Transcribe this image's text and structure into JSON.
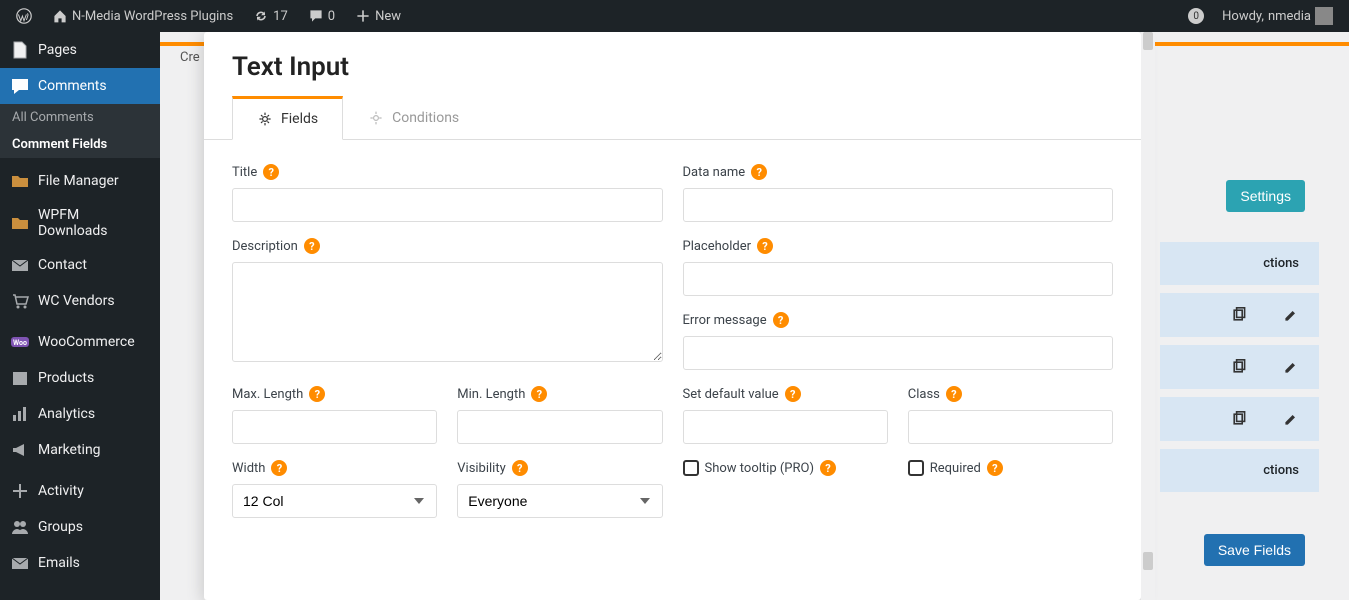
{
  "admin_bar": {
    "site_name": "N-Media WordPress Plugins",
    "updates": "17",
    "comments": "0",
    "new": "New",
    "howdy_prefix": "Howdy, ",
    "username": "nmedia",
    "notif_count": "0"
  },
  "sidebar": {
    "items": [
      {
        "label": "Pages",
        "icon": "page"
      },
      {
        "label": "Comments",
        "icon": "comment",
        "current": true
      },
      {
        "label": "File Manager",
        "icon": "folder"
      },
      {
        "label": "WPFM Downloads",
        "icon": "download"
      },
      {
        "label": "Contact",
        "icon": "mail"
      },
      {
        "label": "WC Vendors",
        "icon": "cart"
      },
      {
        "label": "WooCommerce",
        "icon": "woo"
      },
      {
        "label": "Products",
        "icon": "box"
      },
      {
        "label": "Analytics",
        "icon": "chart"
      },
      {
        "label": "Marketing",
        "icon": "mega"
      },
      {
        "label": "Activity",
        "icon": "plus"
      },
      {
        "label": "Groups",
        "icon": "group"
      },
      {
        "label": "Emails",
        "icon": "mail"
      }
    ],
    "sub": [
      {
        "label": "All Comments"
      },
      {
        "label": "Comment Fields",
        "current": true
      }
    ]
  },
  "background": {
    "crumb": "Cre",
    "settings_btn": "Settings",
    "save_btn": "Save Fields",
    "col_header": "ctions"
  },
  "modal": {
    "title": "Text Input",
    "tabs": [
      {
        "label": "Fields",
        "active": true
      },
      {
        "label": "Conditions"
      }
    ],
    "fields": {
      "title": "Title",
      "data_name": "Data name",
      "description": "Description",
      "placeholder": "Placeholder",
      "error_message": "Error message",
      "max_length": "Max. Length",
      "min_length": "Min. Length",
      "set_default": "Set default value",
      "class": "Class",
      "width": "Width",
      "visibility": "Visibility",
      "show_tooltip": "Show tooltip (PRO)",
      "required": "Required"
    },
    "selects": {
      "width": "12 Col",
      "visibility": "Everyone"
    }
  }
}
